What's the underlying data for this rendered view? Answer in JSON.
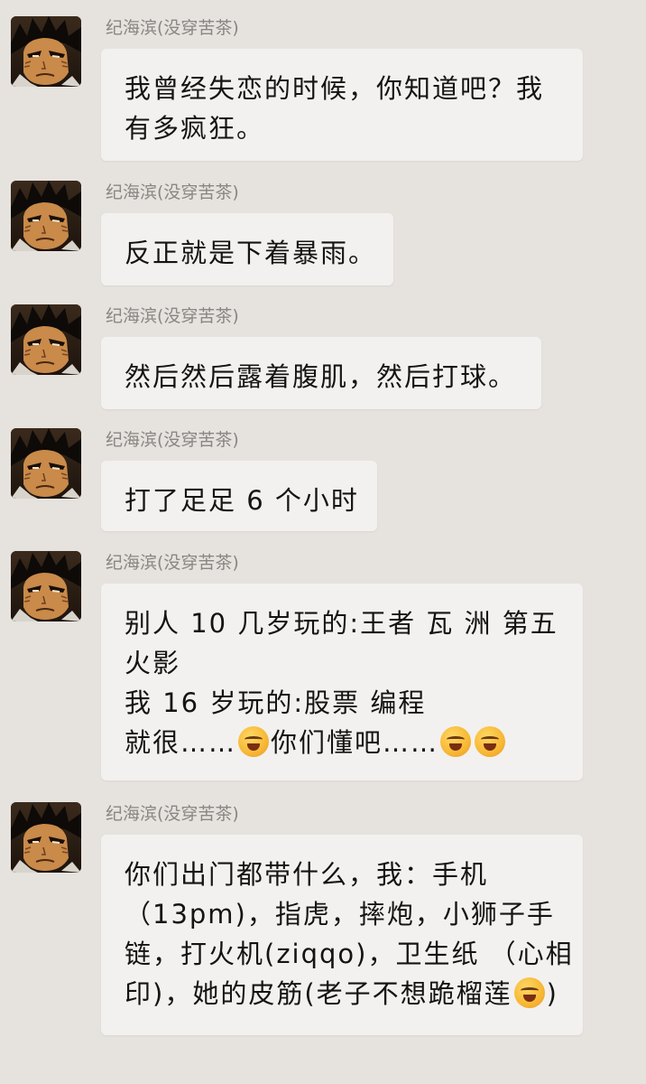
{
  "chat": {
    "sender_name": "纪海滨(没穿苦茶)",
    "messages": [
      {
        "lines": [
          "我曾经失恋的时候，你知道吧？我",
          "有多疯狂。"
        ]
      },
      {
        "lines": [
          "反正就是下着暴雨。"
        ]
      },
      {
        "lines": [
          "然后然后露着腹肌，然后打球。"
        ]
      },
      {
        "lines": [
          "打了足足 6 个小时"
        ]
      },
      {
        "lines": [
          "别人 10 几岁玩的:王者 瓦 洲 第五",
          "火影",
          "我 16 岁玩的:股票 编程"
        ],
        "last_line_parts": [
          "就很……",
          "你们懂吧……"
        ]
      },
      {
        "lines": [
          "你们出门都带什么，我：手机",
          "（13pm)，指虎，摔炮，小狮子手",
          "链，打火机(ziqqo)，卫生纸 （心相"
        ],
        "last_line_parts": [
          "印)，她的皮筋(老子不想跪榴莲",
          ")"
        ]
      }
    ],
    "emoji_name": "loudly-crying-laughing-emoji"
  }
}
